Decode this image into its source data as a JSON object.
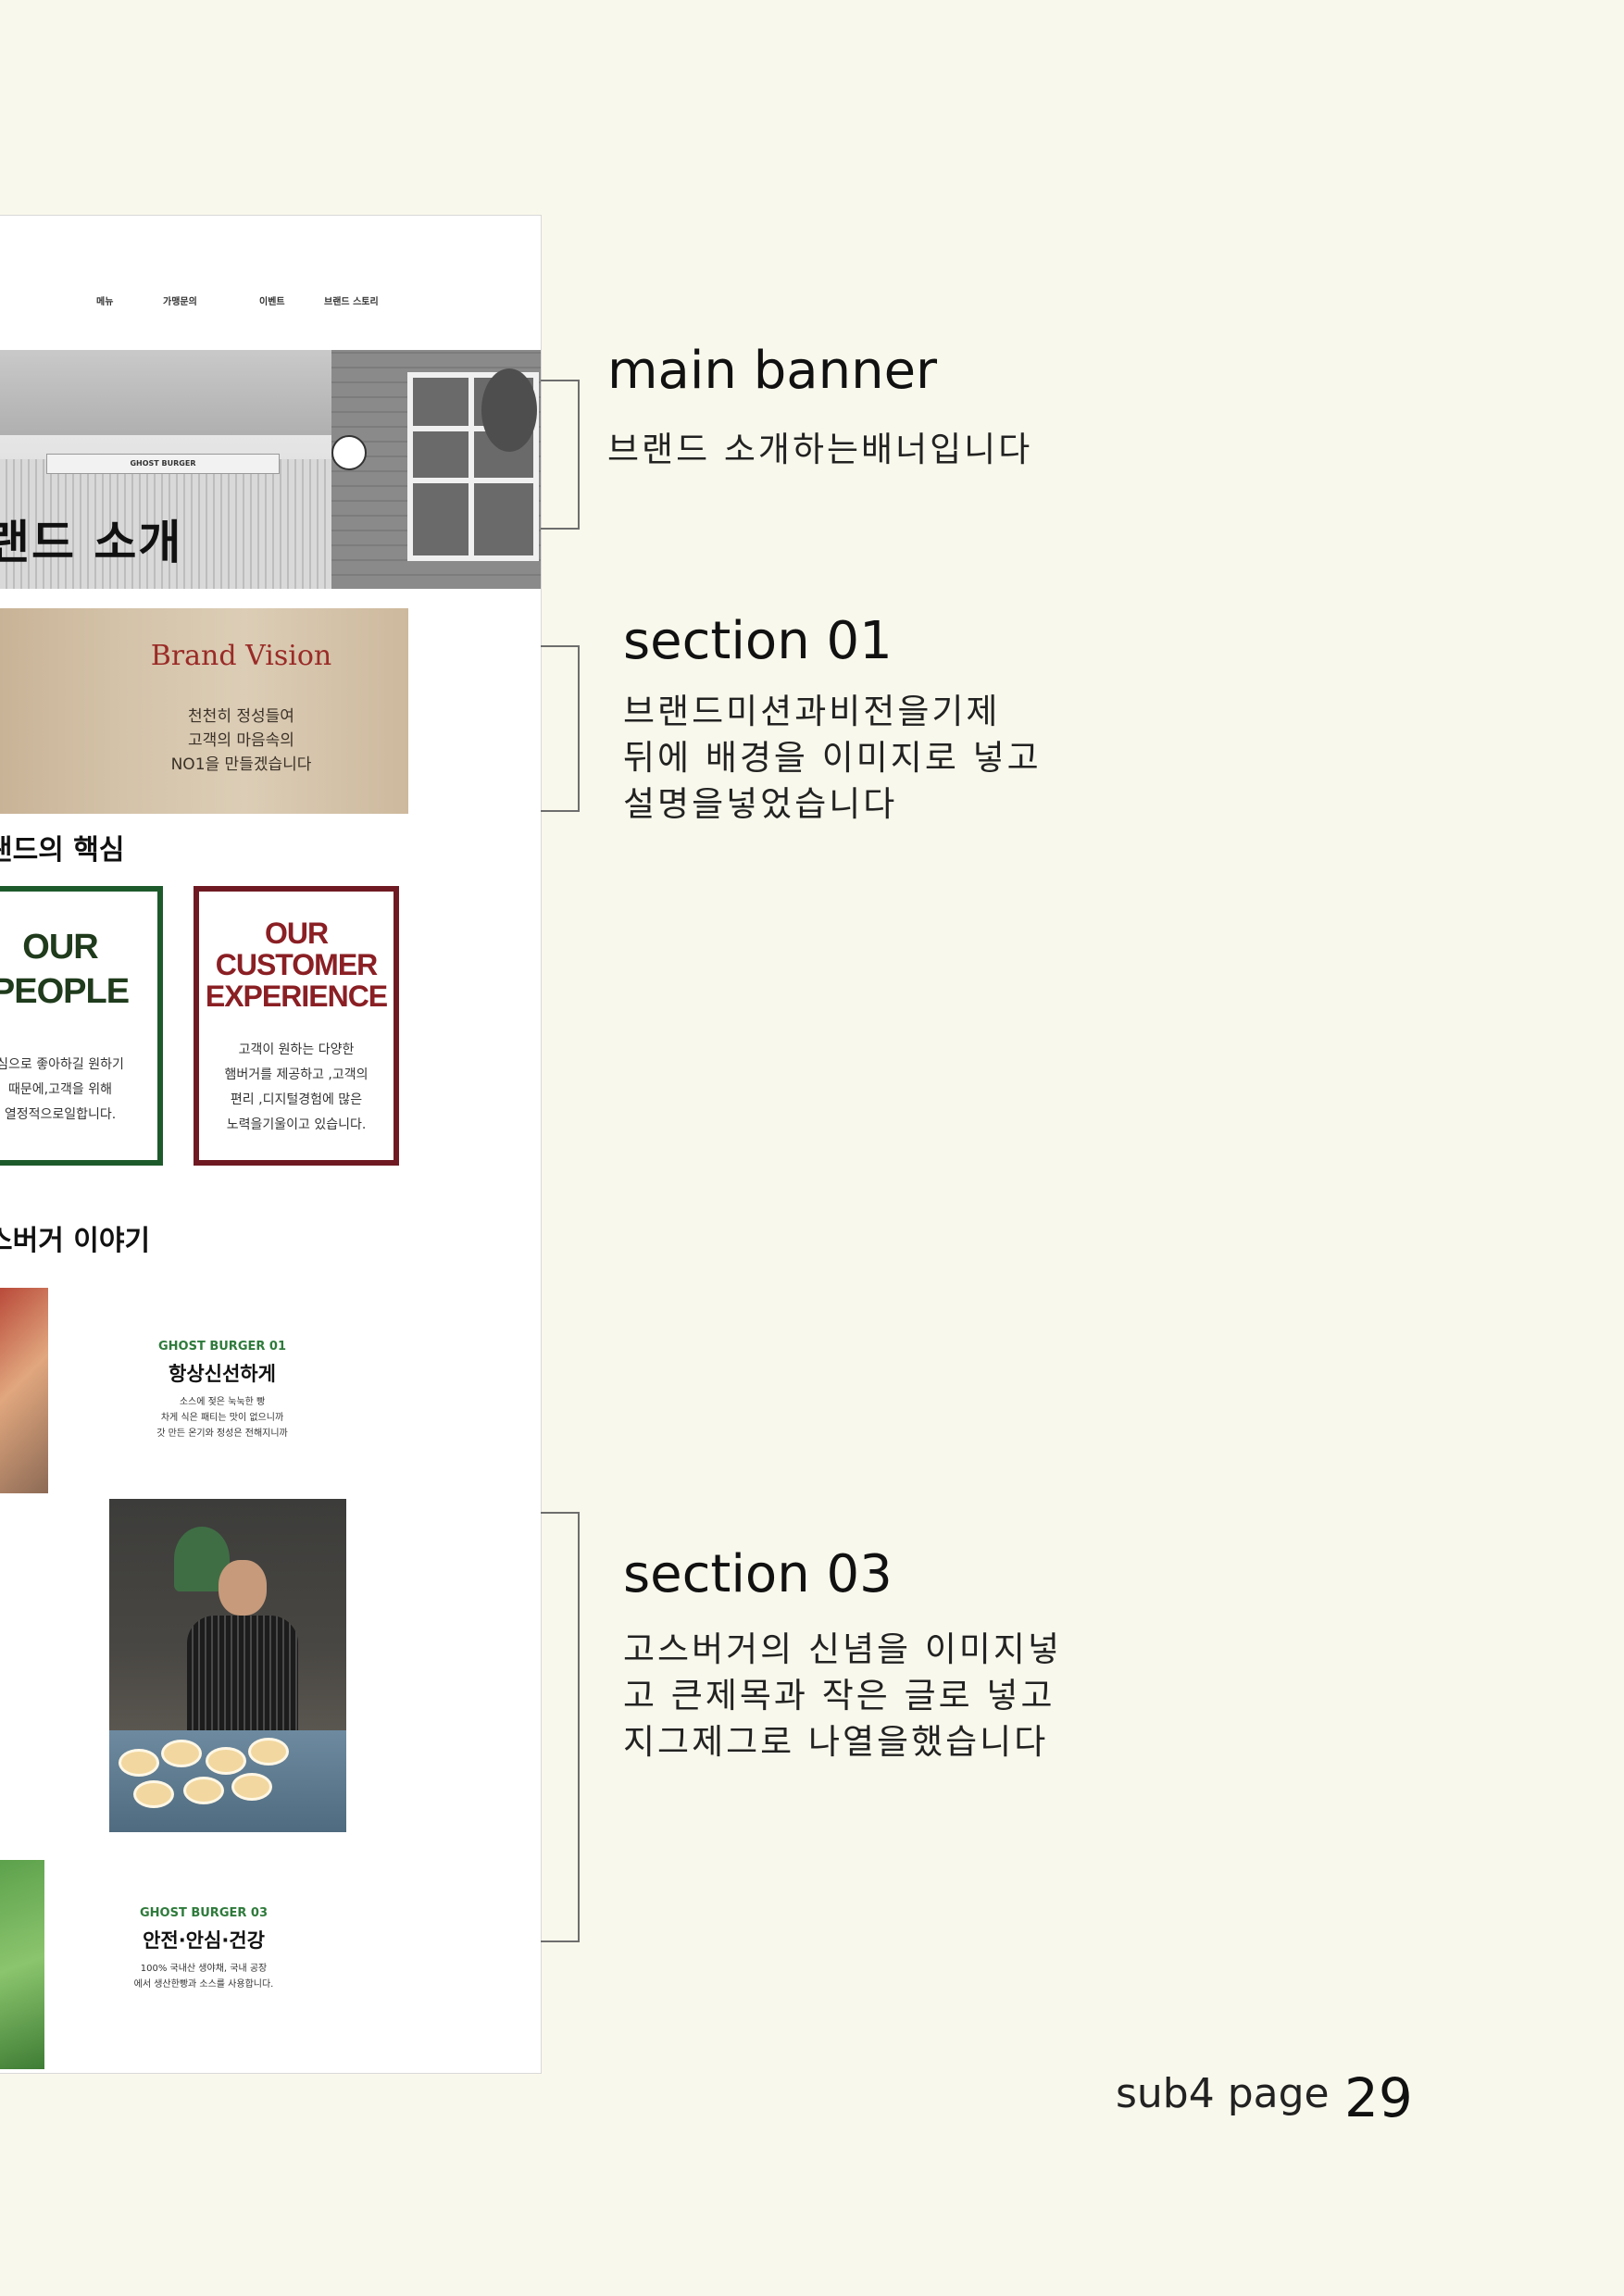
{
  "website": {
    "nav": [
      "메뉴",
      "가맹문의",
      "이벤트",
      "브랜드 스토리"
    ],
    "hero": {
      "sign_text": "GHOST BURGER",
      "title": "랜드 소개"
    },
    "vision": {
      "title": "Brand Vision",
      "description": "천천히 정성들여\n고객의 마음속의\nNO1을 만들겠습니다"
    },
    "core_heading": "랜드의 핵심",
    "cards": [
      {
        "title": "OUR\nPEOPLE",
        "description": "심으로 좋아하길 원하기\n때문에,고객을 위해\n열정적으로일합니다."
      },
      {
        "title": "OUR\nCUSTOMER\nEXPERIENCE",
        "description": "고객이 원하는 다양한\n햄버거를 제공하고 ,고객의\n편리 ,디지털경험에 많은\n노력을기울이고 있습니다."
      }
    ],
    "story_heading": "스버거 이야기",
    "stories": [
      {
        "label": "GHOST BURGER 01",
        "title": "항상신선하게",
        "description": "소스에 젖은 눅눅한 빵\n차게 식은 패티는 맛이 없으니까\n갓 만든 온기와 정성은 전해지니까"
      },
      {
        "label": "GHOST BURGER 03",
        "title": "안전·안심·건강",
        "description": "100% 국내산 생야채, 국내 공장\n에서 생산한빵과 소스를 사용합니다."
      }
    ]
  },
  "annotations": [
    {
      "title": "main banner",
      "description": "브랜드 소개하는배너입니다"
    },
    {
      "title": "section 01",
      "description": "브랜드미션과비전을기제\n뒤에 배경을 이미지로 넣고\n설명을넣었습니다"
    },
    {
      "title": "section 03",
      "description": "고스버거의 신념을 이미지넣\n고 큰제목과 작은 글로 넣고\n지그제그로 나열을했습니다"
    }
  ],
  "footer": {
    "label": "sub4 page",
    "page_number": "29"
  },
  "colors": {
    "background": "#f9f8ec",
    "vision_title": "#9a2b27",
    "people_border": "#1d5a2b",
    "customer_border": "#6f1a22",
    "story_label": "#2e7a3b"
  }
}
